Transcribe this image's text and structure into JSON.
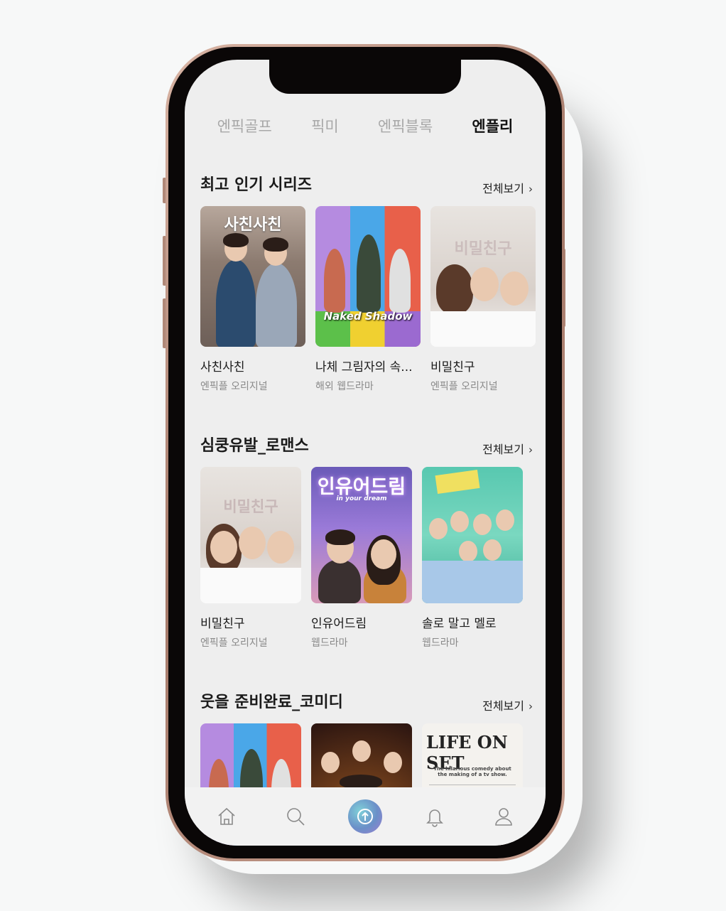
{
  "tabs": [
    "엔픽골프",
    "픽미",
    "엔픽블록",
    "엔플리"
  ],
  "active_tab": "엔플리",
  "see_all_label": "전체보기",
  "sections": [
    {
      "title": "최고 인기 시리즈",
      "items": [
        {
          "title": "사친사친",
          "subtitle": "엔픽플 오리지널",
          "poster_text": "사친사친"
        },
        {
          "title": "나체 그림자의 속...",
          "subtitle": "해외 웹드라마",
          "poster_text": "Naked Shadow"
        },
        {
          "title": "비밀친구",
          "subtitle": "엔픽플 오리지널",
          "poster_text": "비밀친구"
        }
      ]
    },
    {
      "title": "심쿵유발_로맨스",
      "items": [
        {
          "title": "비밀친구",
          "subtitle": "엔픽플 오리지널",
          "poster_text": "비밀친구"
        },
        {
          "title": "인유어드림",
          "subtitle": "웹드라마",
          "poster_text": "인유어드림",
          "poster_subtext": "in your dream"
        },
        {
          "title": "솔로 말고 멜로",
          "subtitle": "웹드라마",
          "poster_text": ""
        }
      ]
    },
    {
      "title": "웃을 준비완료_코미디",
      "items": [
        {
          "title": "",
          "subtitle": "",
          "poster_text": ""
        },
        {
          "title": "",
          "subtitle": "",
          "poster_text": ""
        },
        {
          "title": "",
          "subtitle": "",
          "poster_text": "LIFE ON SET",
          "poster_subtext": "The hilarious comedy about the making of a tv show."
        }
      ]
    }
  ],
  "bottom_nav": [
    "home-icon",
    "search-icon",
    "play-upload-icon",
    "bell-icon",
    "profile-icon"
  ],
  "colors": {
    "accent_gradient_start": "#7fd0d8",
    "accent_gradient_end": "#9c7fd0",
    "frame": "#b08878"
  }
}
